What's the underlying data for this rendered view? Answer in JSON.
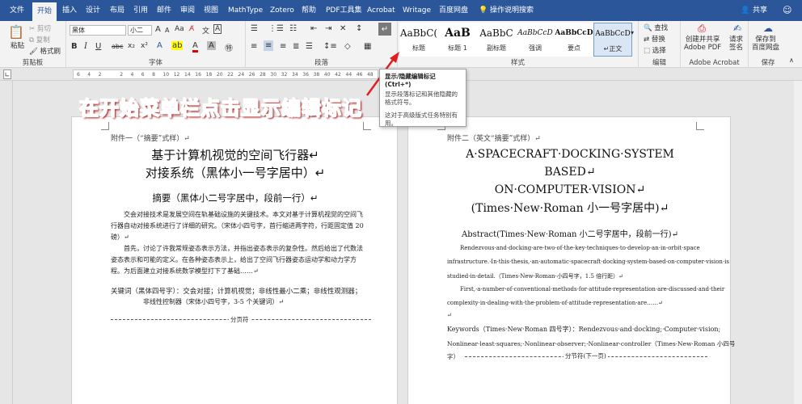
{
  "menu": {
    "tabs": [
      "文件",
      "开始",
      "插入",
      "设计",
      "布局",
      "引用",
      "邮件",
      "审阅",
      "视图",
      "MathType",
      "Zotero",
      "帮助",
      "PDF工具集",
      "Acrobat",
      "Writage",
      "百度网盘"
    ],
    "active": "开始",
    "tell_me": "操作说明搜索",
    "share": "共享"
  },
  "ribbon": {
    "clipboard": {
      "paste": "粘贴",
      "cut": "剪切",
      "copy": "复制",
      "format_painter": "格式刷",
      "label": "剪贴板"
    },
    "font": {
      "name": "黑体",
      "size": "小二",
      "label": "字体",
      "size_up": "A",
      "size_down": "A",
      "bold": "B",
      "italic": "I",
      "underline": "U",
      "strike": "abc",
      "sub": "x₂",
      "sup": "x²",
      "color_a": "A",
      "aa": "Aa"
    },
    "paragraph": {
      "label": "段落"
    },
    "styles": {
      "label": "样式",
      "items": [
        {
          "preview": "AaBbC(",
          "name": "标题"
        },
        {
          "preview": "AaB",
          "name": "标题 1"
        },
        {
          "preview": "AaBbC",
          "name": "副标题"
        },
        {
          "preview": "AaBbCcD",
          "name": "强调"
        },
        {
          "preview": "AaBbCcD",
          "name": "要点"
        },
        {
          "preview": "AaBbCcD",
          "name": "↵正文"
        }
      ]
    },
    "editing": {
      "find": "查找",
      "replace": "替换",
      "select": "选择",
      "label": "编辑"
    },
    "acrobat": {
      "create_share": "创建并共享\nAdobe PDF",
      "request_sign": "请求\n签名",
      "label": "Adobe Acrobat"
    },
    "baidu": {
      "save": "保存到\n百度网盘",
      "label": "保存"
    }
  },
  "ruler": {
    "ticks": [
      "6",
      "4",
      "2",
      "",
      "2",
      "4",
      "6",
      "8",
      "10",
      "12",
      "14",
      "16",
      "18",
      "20",
      "22",
      "24",
      "26",
      "28",
      "30",
      "32",
      "34",
      "36",
      "38",
      "40",
      "42",
      "44",
      "46",
      "48"
    ]
  },
  "tooltip": {
    "title": "显示/隐藏编辑标记 (Ctrl+*)",
    "line1": "显示段落标记和其他隐藏的格式符号。",
    "line2": "这对于高级版式任务特别有用。"
  },
  "banner": "在开始菜单栏点击显示编辑标记",
  "left_page": {
    "header": "附件一（“摘要”式样）↵",
    "title1": "基于计算机视觉的空间飞行器↵",
    "title2": "对接系统（黑体小一号字居中）↵",
    "abstract_head": "摘要（黑体小二号字居中，段前一行）↵",
    "p1": "交会对接技术是发展空间在轨基础设施的关键技术。本文对基于计算机视觉的空间飞",
    "p2": "行器自动对接系统进行了详细的研究。（宋体小四号字，首行缩进两字符，行距固定值 20",
    "p3": "磅）↵",
    "p4": "首先，讨论了许我常规姿态表示方法，并指出姿态表示的复杂性。然后给出了代数法",
    "p5": "姿态表示和可能的定义。在各种姿态表示上，给出了空间飞行器姿态运动学和动力学方",
    "p6": "程。为后面建立对接系统数学模型打下了基础……↵",
    "keywords1": "关键词（黑体四号字）：交会对接；计算机视觉；非线性最小二乘；非线性观测器；",
    "keywords2": "非线性控制器（宋体小四号字，3-5 个关键词）↵",
    "page_break": "分页符"
  },
  "right_page": {
    "header": "附件二（英文“摘要”式样）↵",
    "title1": "A·SPACECRAFT·DOCKING·SYSTEM",
    "title2": "BASED↵",
    "title3": "ON·COMPUTER·VISION↵",
    "title4": "(Times·New·Roman 小一号字居中)↵",
    "abstract_head": "Abstract(Times·New·Roman 小二号字居中，段前一行)↵",
    "p1": "Rendezvous·and·docking·are·two·of·the·key·techniques·to·develop·an·in-orbit·space",
    "p2": "infrastructure.·In·this·thesis,·an·automatic·spacecraft·docking·system·based·on·computer·vision·is",
    "p3": "studied·in·detail.（Times·New·Roman·小四号字，1.5 倍行距）↵",
    "p4": "First,·a·number·of·conventional·methods·for·attitude·representation·are·discussed·and·their",
    "p5": "complexity·in·dealing·with·the·problem·of·attitude·representation·are……↵",
    "p6": "↵",
    "keywords1": "Keywords（Times·New·Roman 四号字）：Rendezvous·and·docking;·Computer·vision;",
    "keywords2": "Nonlinear·least·squares;·Nonlinear·observer;·Nonlinear·controller（Times·New·Roman 小四号",
    "keywords3": "字）",
    "section_break": "分节符(下一页)"
  },
  "colors": {
    "accent": "#2b579a",
    "banner": "#d00000",
    "arrow": "#e02020"
  }
}
